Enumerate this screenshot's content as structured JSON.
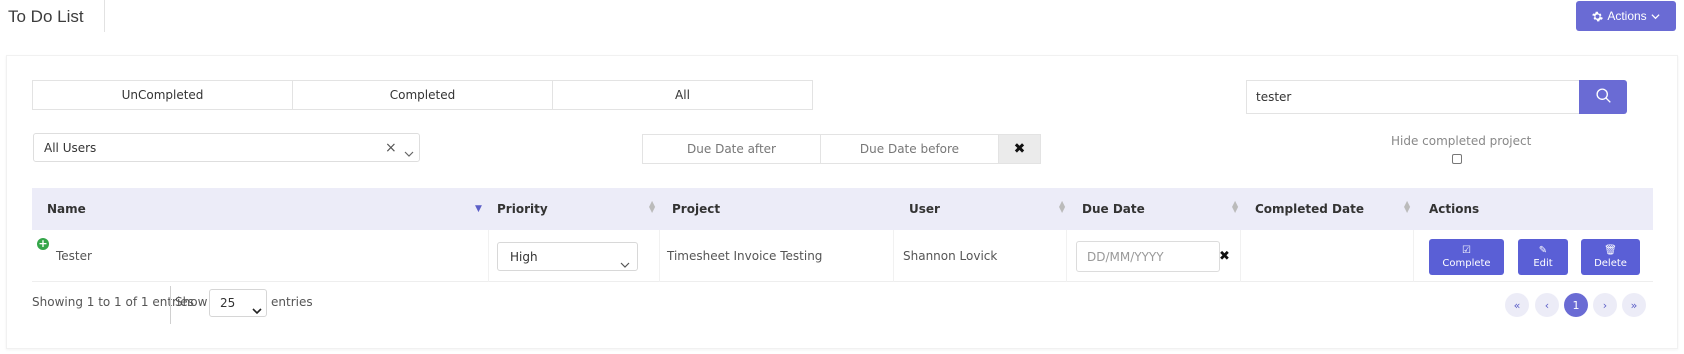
{
  "header": {
    "title": "To Do List",
    "actions_label": "Actions"
  },
  "tabs": [
    {
      "label": "UnCompleted"
    },
    {
      "label": "Completed"
    },
    {
      "label": "All"
    }
  ],
  "search": {
    "value": "tester"
  },
  "filters": {
    "user_value": "All Users",
    "due_after_placeholder": "Due Date after",
    "due_before_placeholder": "Due Date before",
    "hide_completed_label": "Hide completed project"
  },
  "table": {
    "columns": [
      "Name",
      "Priority",
      "Project",
      "User",
      "Due Date",
      "Completed Date",
      "Actions"
    ],
    "rows": [
      {
        "name": "Tester",
        "priority": "High",
        "project": "Timesheet Invoice Testing",
        "user": "Shannon Lovick",
        "due_date_placeholder": "DD/MM/YYYY",
        "completed_date": "",
        "actions": [
          "Complete",
          "Edit",
          "Delete"
        ]
      }
    ]
  },
  "footer": {
    "showing": "Showing 1 to 1 of 1 entries",
    "show_label": "Show",
    "page_length": "25",
    "entries_label": "entries",
    "current_page": "1"
  }
}
